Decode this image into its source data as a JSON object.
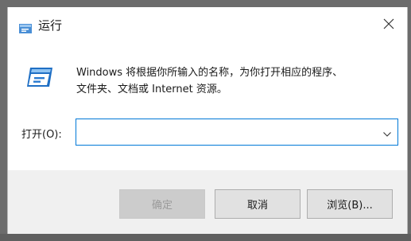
{
  "window": {
    "title": "运行",
    "title_icon": "run-app-icon",
    "close_icon": "close-icon"
  },
  "main": {
    "app_icon": "run-dialog-icon",
    "description_line1": "Windows 将根据你所输入的名称，为你打开相应的程序、",
    "description_line2": "文件夹、文档或 Internet 资源。",
    "open_label": "打开(O):",
    "open_value": "",
    "dropdown_icon": "chevron-down-icon"
  },
  "buttons": {
    "ok_label": "确定",
    "cancel_label": "取消",
    "browse_label": "浏览(B)..."
  },
  "colors": {
    "accent": "#0078d7",
    "button_bar": "#f0f0f0",
    "button_face": "#e1e1e1"
  }
}
